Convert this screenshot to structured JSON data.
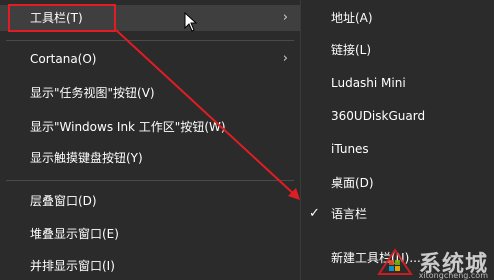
{
  "main_menu": {
    "items": [
      {
        "label": "工具栏(T)",
        "has_submenu": true
      },
      {
        "label": "Cortana(O)",
        "has_submenu": true
      },
      {
        "label": "显示\"任务视图\"按钮(V)",
        "has_submenu": false
      },
      {
        "label": "显示\"Windows Ink 工作区\"按钮(W)",
        "has_submenu": false
      },
      {
        "label": "显示触摸键盘按钮(Y)",
        "has_submenu": false
      },
      {
        "label": "层叠窗口(D)",
        "has_submenu": false
      },
      {
        "label": "堆叠显示窗口(E)",
        "has_submenu": false
      },
      {
        "label": "并排显示窗口(I)",
        "has_submenu": false
      }
    ],
    "submenu_arrow": "›"
  },
  "sub_menu": {
    "items": [
      {
        "label": "地址(A)",
        "checked": false
      },
      {
        "label": "链接(L)",
        "checked": false
      },
      {
        "label": "Ludashi Mini",
        "checked": false
      },
      {
        "label": "360UDiskGuard",
        "checked": false
      },
      {
        "label": "iTunes",
        "checked": false
      },
      {
        "label": "桌面(D)",
        "checked": false
      },
      {
        "label": "语言栏",
        "checked": true
      },
      {
        "label": "新建工具栏(N)...",
        "checked": false
      }
    ],
    "check_glyph": "✓"
  },
  "watermark": {
    "text": "系统城",
    "url": "xitongcheng.com"
  },
  "colors": {
    "menu_bg": "#2b2b2b",
    "highlight": "#e11d23",
    "text": "#ffffff"
  }
}
